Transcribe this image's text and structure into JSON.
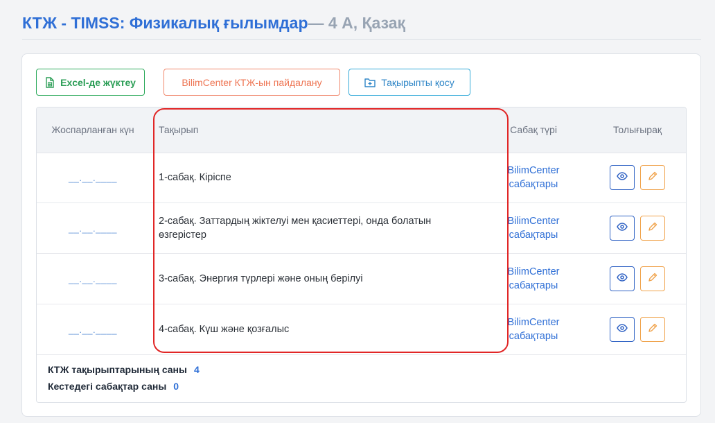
{
  "page": {
    "title": "КТЖ - TIMSS: Физикалық ғылымдар",
    "subtitle": "— 4 А, Қазақ"
  },
  "toolbar": {
    "excel_label": "Excel-де жүктеу",
    "bilim_label": "BilimCenter КТЖ-ын пайдалану",
    "add_topic_label": "Тақырыпты қосу"
  },
  "table": {
    "headers": {
      "date": "Жоспарланған күн",
      "topic": "Тақырып",
      "type": "Сабақ түрі",
      "more": "Толығырақ"
    },
    "rows": [
      {
        "date": "__.__.____",
        "topic": "1-сабақ. Кіріспе",
        "type": "BilimCenter сабақтары"
      },
      {
        "date": "__.__.____",
        "topic": "2-сабақ. Заттардың жіктелуі мен қасиеттері, онда болатын өзгерістер",
        "type": "BilimCenter сабақтары"
      },
      {
        "date": "__.__.____",
        "topic": "3-сабақ. Энергия түрлері және оның берілуі",
        "type": "BilimCenter сабақтары"
      },
      {
        "date": "__.__.____",
        "topic": "4-сабақ. Күш және қозғалыс",
        "type": "BilimCenter сабақтары"
      }
    ]
  },
  "summary": {
    "topics_count_label": "КТЖ тақырыптарының саны",
    "topics_count": "4",
    "lessons_count_label": "Кестедегі сабақтар саны",
    "lessons_count": "0"
  },
  "colors": {
    "accent": "#2f6fd6",
    "excel": "#2a9d55",
    "bilim": "#ee7452",
    "add": "#2f86c7",
    "highlight": "#e12626",
    "edit": "#f0a24a"
  },
  "icons": {
    "excel": "spreadsheet-file-icon",
    "add": "folder-plus-icon",
    "view": "eye-icon",
    "edit": "pencil-icon"
  }
}
